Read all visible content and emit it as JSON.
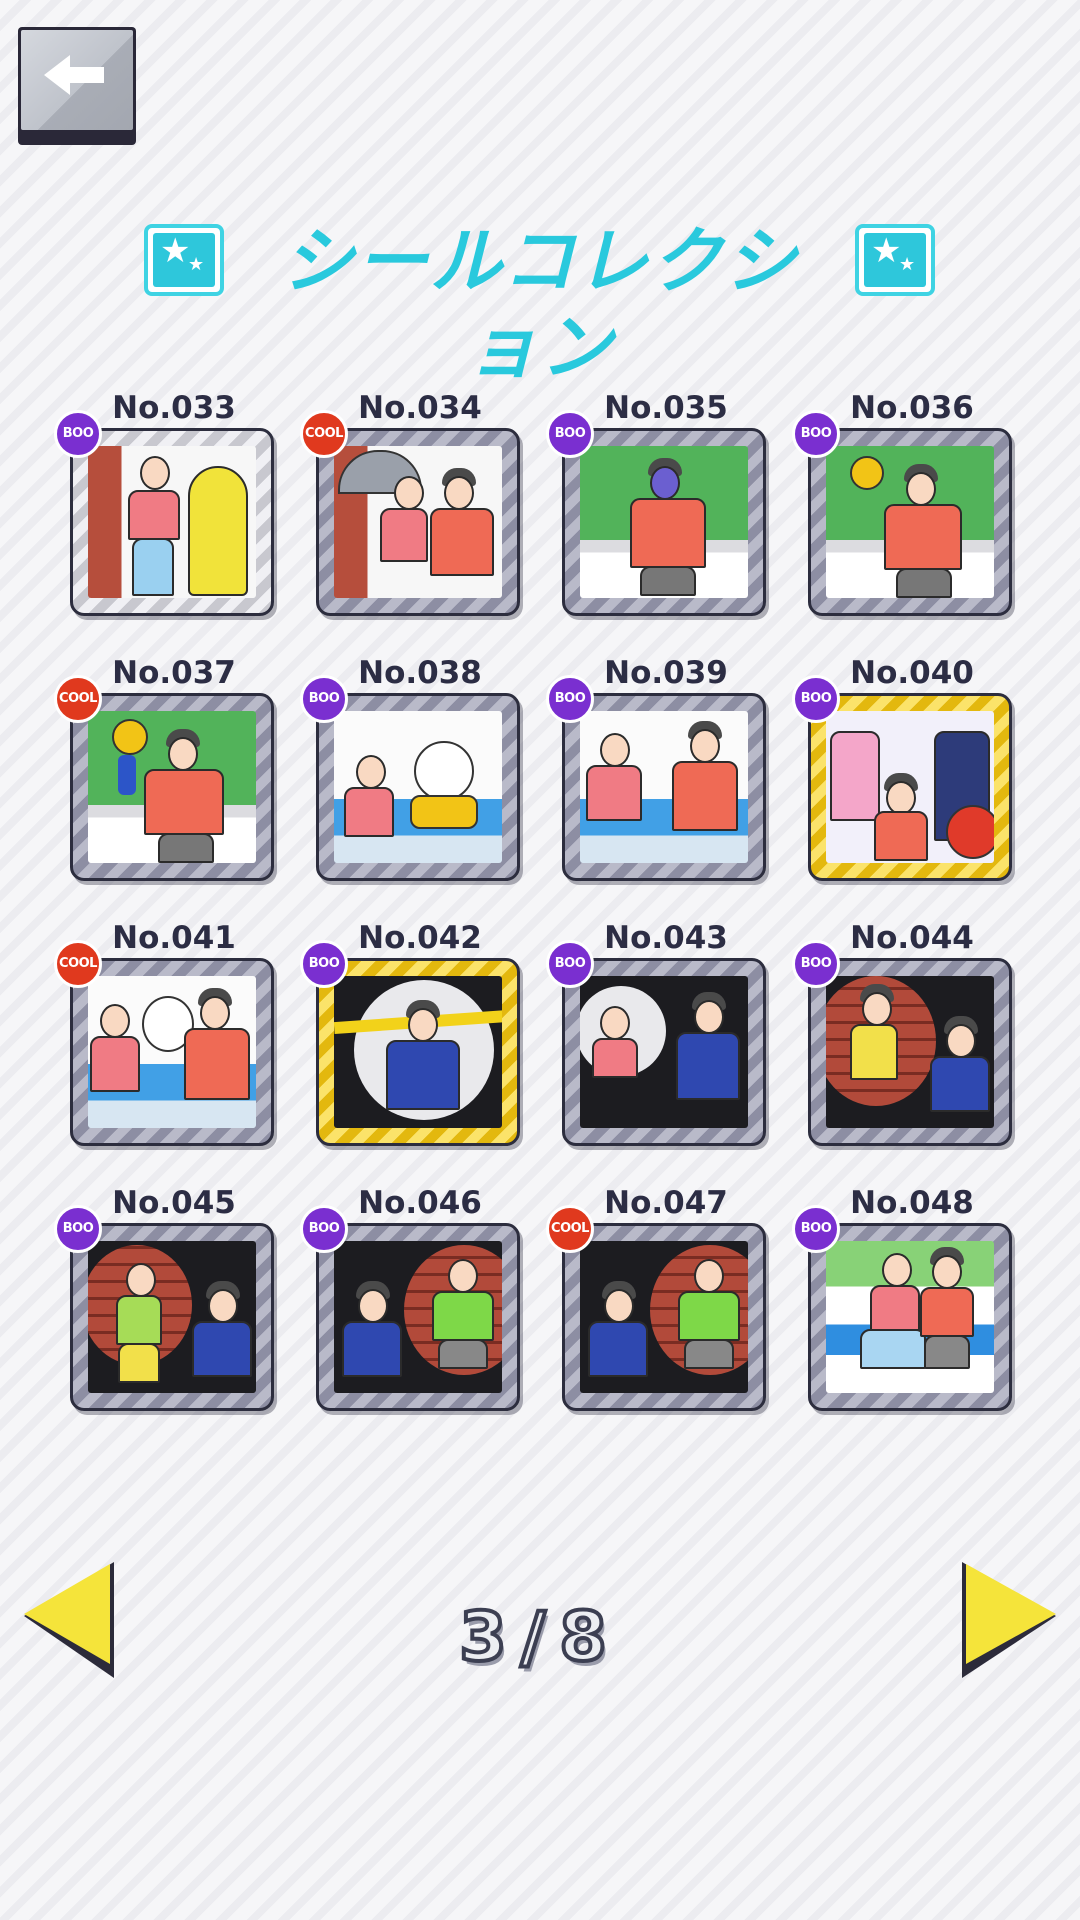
{
  "header": {
    "back_button": {
      "icon": "back-arrow-icon"
    },
    "title": "シールコレクション",
    "title_icons": [
      "star-sticker-icon",
      "star-sticker-icon"
    ]
  },
  "stickers": [
    {
      "number": "No.033",
      "badge": "BOO",
      "frame": "silver",
      "scene": "rain"
    },
    {
      "number": "No.034",
      "badge": "COOL",
      "frame": "normal",
      "scene": "rain"
    },
    {
      "number": "No.035",
      "badge": "BOO",
      "frame": "normal",
      "scene": "green"
    },
    {
      "number": "No.036",
      "badge": "BOO",
      "frame": "normal",
      "scene": "green"
    },
    {
      "number": "No.037",
      "badge": "COOL",
      "frame": "normal",
      "scene": "green"
    },
    {
      "number": "No.038",
      "badge": "BOO",
      "frame": "normal",
      "scene": "clinic"
    },
    {
      "number": "No.039",
      "badge": "BOO",
      "frame": "normal",
      "scene": "clinic"
    },
    {
      "number": "No.040",
      "badge": "BOO",
      "frame": "gold",
      "scene": "gold"
    },
    {
      "number": "No.041",
      "badge": "COOL",
      "frame": "normal",
      "scene": "clinic"
    },
    {
      "number": "No.042",
      "badge": "BOO",
      "frame": "gold",
      "scene": "spot-light"
    },
    {
      "number": "No.043",
      "badge": "BOO",
      "frame": "normal",
      "scene": "spot-light"
    },
    {
      "number": "No.044",
      "badge": "BOO",
      "frame": "normal",
      "scene": "spot-brick"
    },
    {
      "number": "No.045",
      "badge": "BOO",
      "frame": "normal",
      "scene": "spot-brick"
    },
    {
      "number": "No.046",
      "badge": "BOO",
      "frame": "normal",
      "scene": "spot-brick"
    },
    {
      "number": "No.047",
      "badge": "COOL",
      "frame": "normal",
      "scene": "spot-brick"
    },
    {
      "number": "No.048",
      "badge": "BOO",
      "frame": "normal",
      "scene": "sky"
    }
  ],
  "pagination": {
    "current": "3",
    "separator": "/",
    "total": "8",
    "prev_icon": "triangle-left-icon",
    "next_icon": "triangle-right-icon"
  },
  "colors": {
    "title": "#29c9dd",
    "boo_badge": "#7a2fd0",
    "cool_badge": "#e0391e",
    "arrow": "#f5e43a"
  }
}
